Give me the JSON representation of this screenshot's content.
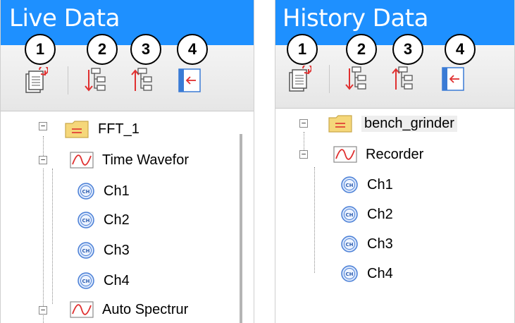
{
  "live": {
    "title": "Live Data",
    "badges": [
      "1",
      "2",
      "3",
      "4"
    ],
    "toolbar": {
      "refresh_icon": "refresh-document-icon",
      "expand_icon": "expand-tree-down-icon",
      "collapse_icon": "collapse-tree-up-icon",
      "pin_icon": "collapse-panel-left-icon"
    },
    "tree": {
      "root": "FFT_1",
      "groups": [
        {
          "label": "Time Wavefor",
          "channels": [
            "Ch1",
            "Ch2",
            "Ch3",
            "Ch4"
          ]
        },
        {
          "label": "Auto Spectrur",
          "channels": []
        }
      ]
    }
  },
  "history": {
    "title": "History Data",
    "badges": [
      "1",
      "2",
      "3",
      "4"
    ],
    "tree": {
      "root": "bench_grinder",
      "groups": [
        {
          "label": "Recorder",
          "channels": [
            "Ch1",
            "Ch2",
            "Ch3",
            "Ch4"
          ]
        }
      ]
    }
  },
  "colors": {
    "titlebar": "#1e90ff",
    "wave_icon": "#e03030",
    "channel_icon": "#4a7fd6",
    "folder": "#f5d77a"
  }
}
